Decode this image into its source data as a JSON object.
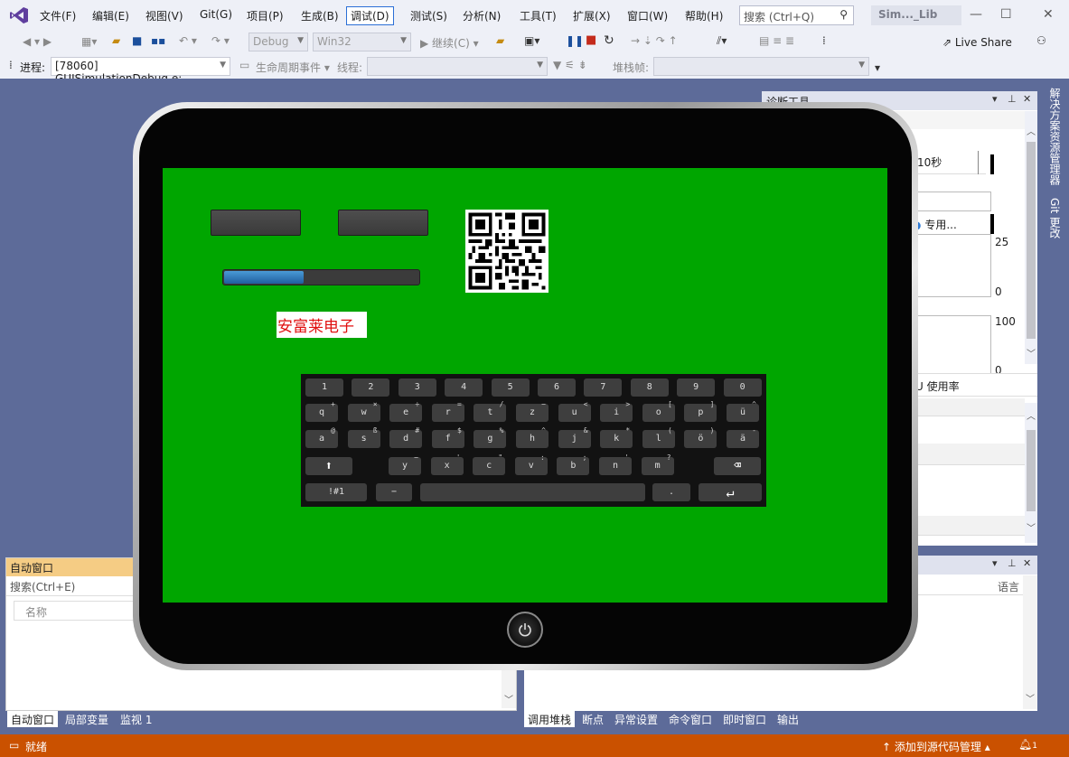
{
  "menu": {
    "items": [
      "文件(F)",
      "编辑(E)",
      "视图(V)",
      "Git(G)",
      "项目(P)",
      "生成(B)",
      "调试(D)",
      "测试(S)",
      "分析(N)",
      "工具(T)",
      "扩展(X)",
      "窗口(W)",
      "帮助(H)"
    ],
    "active_index": 6,
    "search_placeholder": "搜索 (Ctrl+Q)",
    "solution_name": "Sim..._Lib"
  },
  "toolbar1": {
    "config": "Debug",
    "platform": "Win32",
    "continue_label": "继续(C)",
    "live_share_label": "Live Share"
  },
  "toolbar2": {
    "process_label": "进程:",
    "process_value": "[78060] GUISimulationDebug.e:",
    "lifecycle_label": "生命周期事件",
    "thread_label": "线程:",
    "stackframe_label": "堆栈帧:"
  },
  "right_tabs": {
    "solution_explorer": "解决方案资源管理器",
    "git_changes": "Git 更改"
  },
  "diag": {
    "title": "诊断工具",
    "time_suffix": "10秒",
    "dedicated": "专用...",
    "axis_top_1": "25",
    "axis_bottom_1": "0",
    "axis_top_2": "100",
    "axis_bottom_2": "0",
    "cpu_label": "U 使用率"
  },
  "callstack": {
    "col_lang": "语言"
  },
  "auto": {
    "title": "自动窗口",
    "search_placeholder": "搜索(Ctrl+E)",
    "col_name": "名称"
  },
  "bottom_tabs_left": [
    "自动窗口",
    "局部变量",
    "监视 1"
  ],
  "bottom_tabs_right": [
    "调用堆栈",
    "断点",
    "异常设置",
    "命令窗口",
    "即时窗口",
    "输出"
  ],
  "status": {
    "ready": "就绪",
    "source_control": "添加到源代码管理",
    "notif_count": "1"
  },
  "tablet": {
    "progress": 0.41,
    "company": "安富莱电子",
    "keyboard": {
      "row1": [
        "1",
        "2",
        "3",
        "4",
        "5",
        "6",
        "7",
        "8",
        "9",
        "0"
      ],
      "row2": [
        [
          "q",
          "+"
        ],
        [
          "w",
          "×"
        ],
        [
          "e",
          "÷"
        ],
        [
          "r",
          "="
        ],
        [
          "t",
          "/"
        ],
        [
          "z",
          "−"
        ],
        [
          "u",
          "<"
        ],
        [
          "i",
          ">"
        ],
        [
          "o",
          "["
        ],
        [
          "p",
          "]"
        ],
        [
          "ü",
          "^"
        ]
      ],
      "row3": [
        [
          "a",
          "@"
        ],
        [
          "s",
          "ß"
        ],
        [
          "d",
          "#"
        ],
        [
          "f",
          "$"
        ],
        [
          "g",
          "%"
        ],
        [
          "h",
          "^"
        ],
        [
          "j",
          "&"
        ],
        [
          "k",
          "*"
        ],
        [
          "l",
          "("
        ],
        [
          "ö",
          ")"
        ],
        [
          "ä",
          "-"
        ]
      ],
      "row4": [
        [
          "y",
          "−"
        ],
        [
          "x",
          "'"
        ],
        [
          "c",
          "\""
        ],
        [
          "v",
          ":"
        ],
        [
          "b",
          ";"
        ],
        [
          "n",
          "'"
        ],
        [
          "m",
          "?"
        ]
      ],
      "sym_key": "!#1",
      "dash_key": "−",
      "dot_key": "."
    }
  }
}
